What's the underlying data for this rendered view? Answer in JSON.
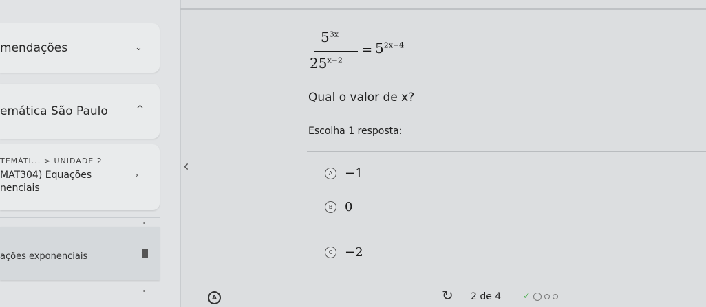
{
  "sidebar": {
    "recommendations_label": "mendações",
    "subject_label": "emática São Paulo",
    "breadcrumb": "TEMÁTI... > UNIDADE 2",
    "module_title_line1": "MAT304) Equações",
    "module_title_line2": "nenciais",
    "topic_label": "ações exponenciais"
  },
  "question": {
    "numerator_base": "5",
    "numerator_exp": "3x",
    "denominator_base": "25",
    "denominator_exp": "x−2",
    "equals": "=",
    "rhs_base": "5",
    "rhs_exp": "2x+4",
    "prompt": "Qual o valor de x?",
    "instruction": "Escolha 1 resposta:"
  },
  "options": [
    {
      "letter": "A",
      "value": "−1"
    },
    {
      "letter": "B",
      "value": "0"
    },
    {
      "letter": "C",
      "value": "−2"
    }
  ],
  "footer": {
    "logo_letter": "A",
    "page_count": "2 de 4"
  },
  "icons": {
    "back": "chevron-left-icon",
    "redo": "redo-icon",
    "check": "check-icon"
  }
}
